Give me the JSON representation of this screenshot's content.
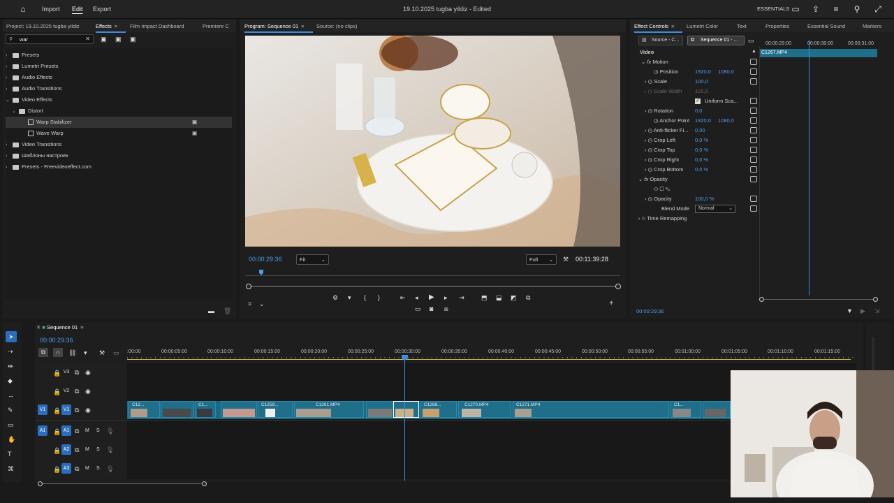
{
  "app": {
    "menu": {
      "import": "Import",
      "edit": "Edit",
      "export": "Export"
    },
    "title": "19.10.2025 tugba yildiz",
    "title_status": "- Edited",
    "workspace": "ESSENTIALS",
    "accent": "#3a8ee6",
    "clip_color": "#1f6f8b"
  },
  "project_panel": {
    "tabs": [
      "Project: 19.10.2025 tugba yildiz",
      "Effects",
      "Film Impact Dashboard",
      "Premiere C"
    ],
    "active_tab": "Effects",
    "search_value": "war",
    "tree": [
      {
        "label": "Presets",
        "kind": "folder",
        "expanded": false
      },
      {
        "label": "Lumetri Presets",
        "kind": "folder",
        "expanded": false
      },
      {
        "label": "Audio Effects",
        "kind": "folder",
        "expanded": false
      },
      {
        "label": "Audio Transitions",
        "kind": "folder",
        "expanded": false
      },
      {
        "label": "Video Effects",
        "kind": "folder",
        "expanded": true
      },
      {
        "label": "Distort",
        "kind": "folder",
        "expanded": true
      },
      {
        "label": "Warp Stabilizer",
        "kind": "effect",
        "selected": true
      },
      {
        "label": "Wave Warp",
        "kind": "effect"
      },
      {
        "label": "Video Transitions",
        "kind": "folder",
        "expanded": false
      },
      {
        "label": "Шаблоны настроек",
        "kind": "folder",
        "expanded": false
      },
      {
        "label": "Presets - Freevideoeffect.com",
        "kind": "folder",
        "expanded": false
      }
    ]
  },
  "program_monitor": {
    "tabs": [
      "Program: Sequence 01",
      "Source: (no clips)"
    ],
    "timecode": "00:00:29:36",
    "fit": "Fit",
    "quality": "Full",
    "duration": "00:11:39:28"
  },
  "effect_controls": {
    "tabs": [
      "Effect Controls",
      "Lumetri Color",
      "Text",
      "Properties",
      "Essential Sound",
      "Markers"
    ],
    "source_label": "Source - C...",
    "sequence_label": "Sequence 01 - ...",
    "mini_ruler": [
      "00:00:29:00",
      "00:00:30:00",
      "00:00:31:00"
    ],
    "clip_name": "C1267.MP4",
    "video_header": "Video",
    "motion": "Motion",
    "position_label": "Position",
    "position_x": "1920,0",
    "position_y": "1080,0",
    "scale_label": "Scale",
    "scale": "100,0",
    "scale_width_label": "Scale Width",
    "scale_width": "100,0",
    "uniform_label": "Uniform Sca...",
    "rotation_label": "Rotation",
    "rotation": "0,0",
    "anchor_label": "Anchor Point",
    "anchor_x": "1920,0",
    "anchor_y": "1080,0",
    "antiflicker_label": "Anti-flicker Fi...",
    "antiflicker": "0,00",
    "crop_left_label": "Crop Left",
    "crop_left": "0,0 %",
    "crop_top_label": "Crop Top",
    "crop_top": "0,0 %",
    "crop_right_label": "Crop Right",
    "crop_right": "0,0 %",
    "crop_bottom_label": "Crop Bottom",
    "crop_bottom": "0,0 %",
    "opacity_header": "Opacity",
    "opacity_label": "Opacity",
    "opacity": "100,0 %",
    "blend_label": "Blend Mode",
    "blend": "Normal",
    "time_remap": "Time Remapping",
    "footer_time": "00:00:29:36"
  },
  "timeline": {
    "sequence_name": "Sequence 01",
    "timecode": "00:00:29:36",
    "ruler": [
      ":00:00",
      "00:00:05:00",
      "00:00:10:00",
      "00:00:15:00",
      "00:00:20:00",
      "00:00:25:00",
      "00:00:30:00",
      "00:00:35:00",
      "00:00:40:00",
      "00:00:45:00",
      "00:00:50:00",
      "00:00:55:00",
      "00:01:00:00",
      "00:01:05:00",
      "00:01:10:00",
      "00:01:15:00"
    ],
    "video_tracks": [
      "V3",
      "V2",
      "V1"
    ],
    "audio_tracks": [
      "A1",
      "A2",
      "A3"
    ],
    "source_patch_v": "V1",
    "source_patch_a": "A1",
    "track_m": "M",
    "track_s": "S",
    "clips": [
      "C12...",
      "C1...",
      "C1259...",
      "C1261.MP4",
      "C1268...",
      "C1270.MP4",
      "C1271.MP4",
      "C1..."
    ]
  }
}
